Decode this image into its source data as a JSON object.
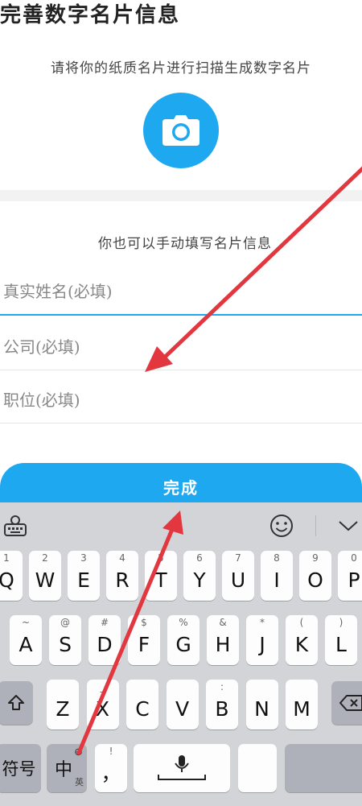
{
  "title": "完善数字名片信息",
  "scan": {
    "hint": "请将你的纸质名片进行扫描生成数字名片"
  },
  "manual": {
    "hint": "你也可以手动填写名片信息",
    "name_placeholder": "真实姓名(必填)",
    "company_placeholder": "公司(必填)",
    "position_placeholder": "职位(必填)"
  },
  "done_label": "完成",
  "colors": {
    "accent": "#1ea8f0",
    "keyboard_bg": "#d3d4d8",
    "annotation_arrow": "#e2373f"
  },
  "keyboard": {
    "toolbar": {
      "keyboard_settings_icon": "keyboard-settings-icon",
      "emoji_icon": "emoji-icon",
      "collapse_icon": "chevron-down-icon"
    },
    "row1": [
      {
        "hint": "1",
        "label": "Q"
      },
      {
        "hint": "2",
        "label": "W"
      },
      {
        "hint": "3",
        "label": "E"
      },
      {
        "hint": "4",
        "label": "R"
      },
      {
        "hint": "5",
        "label": "T"
      },
      {
        "hint": "6",
        "label": "Y"
      },
      {
        "hint": "7",
        "label": "U"
      },
      {
        "hint": "8",
        "label": "I"
      },
      {
        "hint": "9",
        "label": "O"
      },
      {
        "hint": "0",
        "label": "P"
      }
    ],
    "row2": [
      {
        "hint": "~",
        "label": "A"
      },
      {
        "hint": "@",
        "label": "S"
      },
      {
        "hint": "#",
        "label": "D"
      },
      {
        "hint": "$",
        "label": "F"
      },
      {
        "hint": "%",
        "label": "G"
      },
      {
        "hint": "&",
        "label": "H"
      },
      {
        "hint": "*",
        "label": "J"
      },
      {
        "hint": "(",
        "label": "K"
      },
      {
        "hint": ")",
        "label": "L"
      }
    ],
    "row3": [
      {
        "hint": "",
        "label": "Z"
      },
      {
        "hint": "_",
        "label": "X"
      },
      {
        "hint": "",
        "label": "C"
      },
      {
        "hint": "",
        "label": "V"
      },
      {
        "hint": ":",
        "label": "B"
      },
      {
        "hint": "",
        "label": "N"
      },
      {
        "hint": "",
        "label": "M"
      }
    ],
    "bottom": {
      "symbols_label": "符号",
      "lang_label": "中",
      "lang_sub": "英",
      "comma_hint": "!",
      "comma_label": "，"
    }
  }
}
